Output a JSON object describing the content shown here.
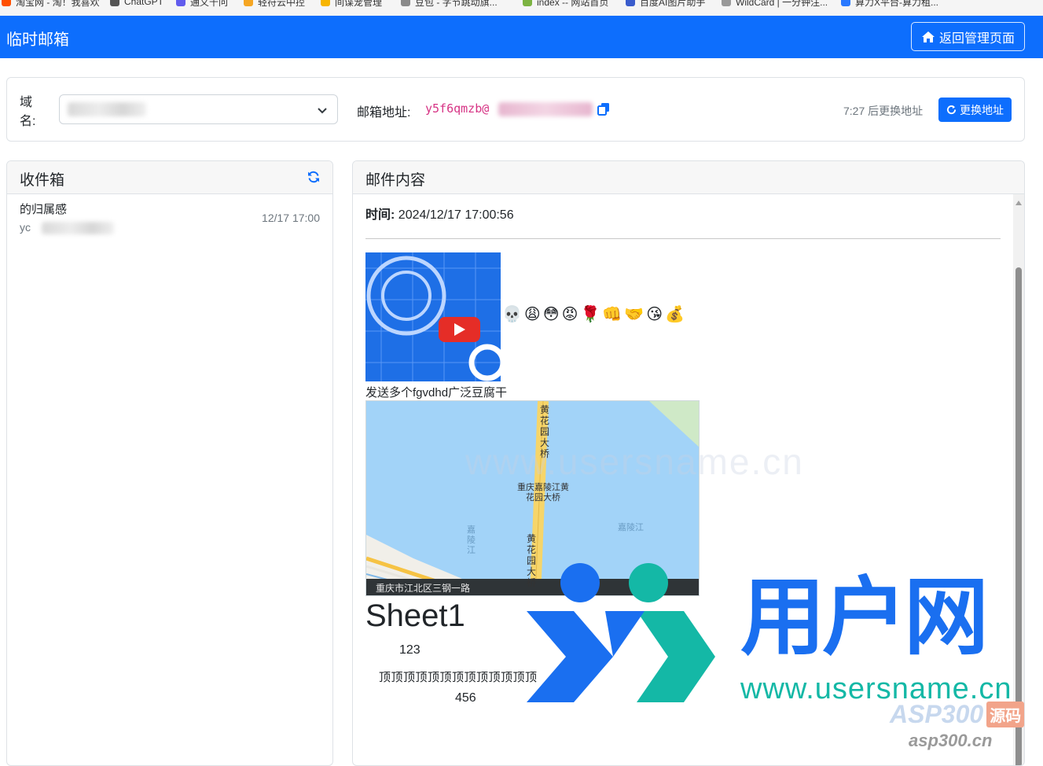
{
  "bookmarks": [
    {
      "label": "淘宝网 - 淘！我喜欢",
      "color": "#ff5000"
    },
    {
      "label": "ChatGPT",
      "color": "#555555"
    },
    {
      "label": "通义千问",
      "color": "#615ced"
    },
    {
      "label": "轻符云中控",
      "color": "#f5a623"
    },
    {
      "label": "间谍宠管理",
      "color": "#f7b500"
    },
    {
      "label": "豆包 - 字节跳动旗...",
      "color": "#8a8a8a"
    },
    {
      "label": "index -- 网站首页",
      "color": "#7cb342"
    },
    {
      "label": "百度AI图片助手",
      "color": "#3a5ccc"
    },
    {
      "label": "WildCard | 一分钟注...",
      "color": "#999999"
    },
    {
      "label": "算力X平台-算力租...",
      "color": "#2979ff"
    }
  ],
  "navbar": {
    "title": "临时邮箱",
    "back_label": "返回管理页面"
  },
  "address": {
    "domain_label": "域名:",
    "address_label": "邮箱地址:",
    "address_value": "y5f6qmzb@",
    "countdown": "7:27 后更换地址",
    "change_label": "更换地址"
  },
  "inbox": {
    "title": "收件箱",
    "items": [
      {
        "subject": "的归属感",
        "from": "yc",
        "time": "12/17 17:00"
      }
    ]
  },
  "content": {
    "title": "邮件内容",
    "time_label": "时间:",
    "time_value": "2024/12/17 17:00:56",
    "emojis": [
      "💀",
      "😩",
      "😳",
      "😡",
      "🌹",
      "👊",
      "🤝",
      "😘",
      "💰"
    ],
    "caption": "发送多个fgvdhd广泛豆腐干",
    "map": {
      "road_label_1": "黄花园大桥",
      "poi_label": "重庆嘉陵江黄花园大桥",
      "river_label": "嘉陵江",
      "side_label": "嘉陵江",
      "road_label_2": "黄花园大桥",
      "address_bar": "重庆市江北区三钢一路"
    },
    "sheet_title": "Sheet1",
    "cell_a": "123",
    "cell_b": "顶顶顶顶顶顶顶顶顶顶顶顶顶",
    "cell_c": "456"
  },
  "watermark": {
    "brand": "用户网",
    "url": "www.usersname.cn",
    "badge": "ASP300",
    "badge_suffix": "源码",
    "badge_url": "asp300.cn"
  },
  "colors": {
    "primary": "#0d6efd",
    "address_pink": "#d63384",
    "watermark_blue": "#1a6ff0",
    "watermark_teal": "#14b8a6"
  }
}
